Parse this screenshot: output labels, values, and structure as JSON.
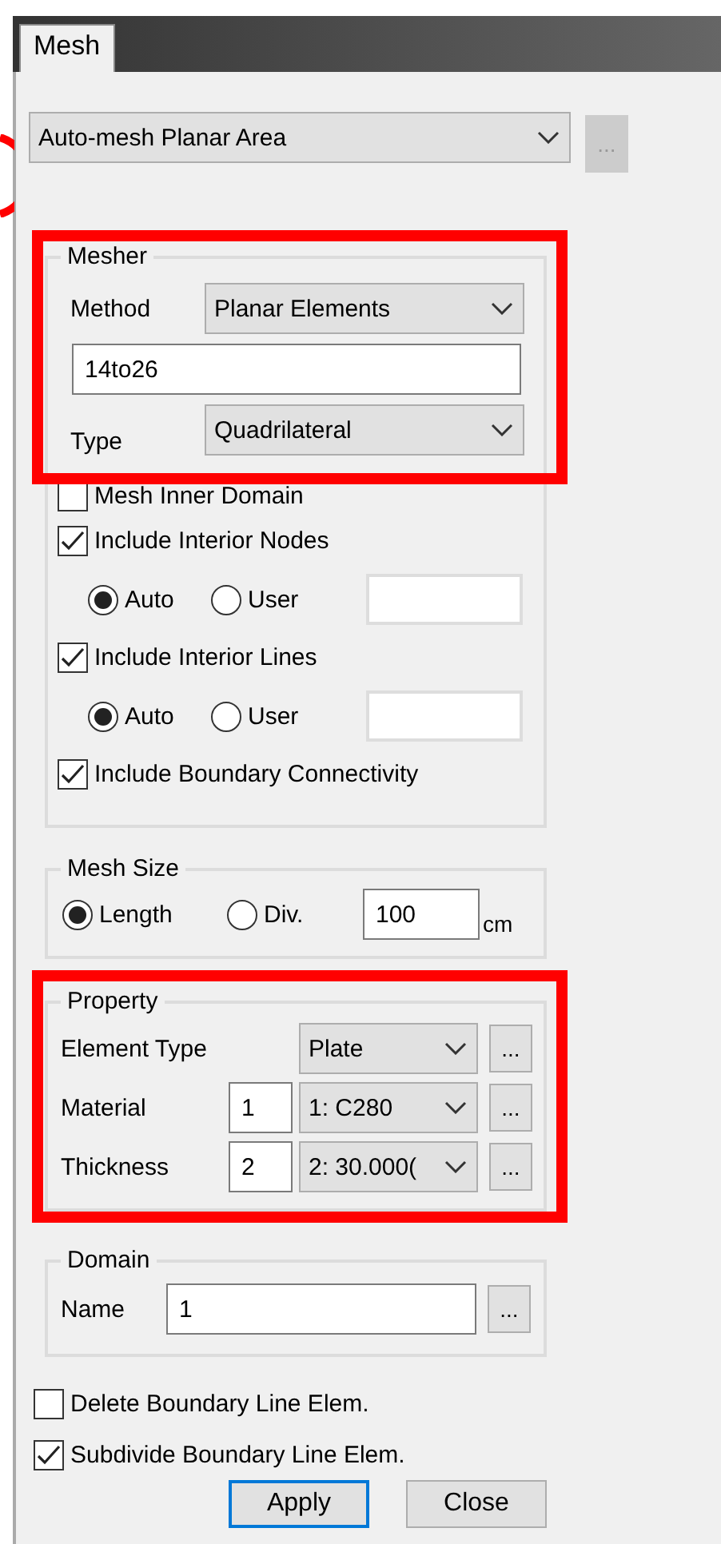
{
  "tab": {
    "label": "Mesh",
    "selected": true
  },
  "marker_circle": true,
  "mode_select": {
    "value": "Auto-mesh Planar Area"
  },
  "mode_more_button": {
    "label": "...",
    "disabled": true
  },
  "mesher": {
    "title": "Mesher",
    "highlighted": true,
    "method": {
      "label": "Method",
      "value": "Planar Elements"
    },
    "name_field": {
      "value": "14to26"
    },
    "type": {
      "label": "Type",
      "value": "Quadrilateral"
    },
    "options": [
      {
        "kind": "checkbox",
        "label": "Mesh Inner Domain",
        "checked": false
      },
      {
        "kind": "checkbox",
        "label": "Include Interior Nodes",
        "checked": true
      },
      {
        "kind": "radios",
        "choices": [
          {
            "label": "Auto",
            "selected": true
          },
          {
            "label": "User",
            "selected": false
          }
        ]
      },
      {
        "kind": "checkbox",
        "label": "Include Interior Lines",
        "checked": true
      },
      {
        "kind": "radios",
        "choices": [
          {
            "label": "Auto",
            "selected": true
          },
          {
            "label": "User",
            "selected": false
          }
        ]
      },
      {
        "kind": "checkbox",
        "label": "Include Boundary Connectivity",
        "checked": true
      }
    ]
  },
  "mesh_size": {
    "title": "Mesh Size",
    "choices": [
      {
        "label": "Length",
        "selected": true
      },
      {
        "label": "Div.",
        "selected": false
      }
    ],
    "value": "100",
    "unit": "cm"
  },
  "property": {
    "title": "Property",
    "highlighted": true,
    "rows": [
      {
        "label": "Element Type",
        "value": "Plate",
        "more": "..."
      },
      {
        "label": "Material",
        "number": "1",
        "value": "1: C280",
        "more": "..."
      },
      {
        "label": "Thickness",
        "number": "2",
        "value": "2: 30.000(",
        "more": "..."
      }
    ]
  },
  "domain": {
    "title": "Domain",
    "label": "Name",
    "value": "1",
    "more": "..."
  },
  "bottom_options": [
    {
      "label": "Delete Boundary Line Elem.",
      "checked": false
    },
    {
      "label": "Subdivide Boundary Line Elem.",
      "checked": true
    }
  ],
  "buttons": [
    {
      "label": "Apply",
      "default": true
    },
    {
      "label": "Close",
      "default": false
    }
  ]
}
